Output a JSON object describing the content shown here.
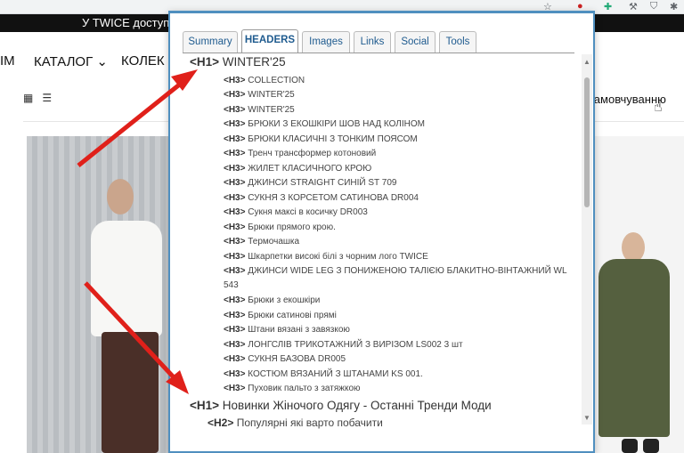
{
  "site": {
    "promo_text": "У TWICE доступн",
    "nav": [
      {
        "label": "ІМ"
      },
      {
        "label": "КАТАЛОГ ⌄"
      },
      {
        "label": "КОЛЕК"
      }
    ],
    "sort_label": "о замовчуванню"
  },
  "popup": {
    "tabs": [
      {
        "label": "Summary"
      },
      {
        "label": "HEADERS"
      },
      {
        "label": "Images"
      },
      {
        "label": "Links"
      },
      {
        "label": "Social"
      },
      {
        "label": "Tools"
      }
    ],
    "active_tab": "HEADERS",
    "headers": [
      {
        "tag": "<H1>",
        "text": "WINTER'25"
      },
      {
        "tag": "<H3>",
        "text": "COLLECTION"
      },
      {
        "tag": "<H3>",
        "text": "WINTER'25"
      },
      {
        "tag": "<H3>",
        "text": "WINTER'25"
      },
      {
        "tag": "<H3>",
        "text": "БРЮКИ З ЕКОШКІРИ ШОВ НАД КОЛІНОМ"
      },
      {
        "tag": "<H3>",
        "text": "БРЮКИ КЛАСИЧНІ З ТОНКИМ ПОЯСОМ"
      },
      {
        "tag": "<H3>",
        "text": "Тренч трансформер котоновий"
      },
      {
        "tag": "<H3>",
        "text": "ЖИЛЕТ КЛАСИЧНОГО КРОЮ"
      },
      {
        "tag": "<H3>",
        "text": "ДЖИНСИ STRAIGHT СИНІЙ ST 709"
      },
      {
        "tag": "<H3>",
        "text": "СУКНЯ З КОРСЕТОМ САТИНОВА DR004"
      },
      {
        "tag": "<H3>",
        "text": "Сукня максі в косичку DR003"
      },
      {
        "tag": "<H3>",
        "text": "Брюки прямого крою."
      },
      {
        "tag": "<H3>",
        "text": "Термочашка"
      },
      {
        "tag": "<H3>",
        "text": "Шкарпетки високі білі з чорним лого TWICE"
      },
      {
        "tag": "<H3>",
        "text": "ДЖИНСИ WIDE LEG З ПОНИЖЕНОЮ ТАЛІЄЮ БЛАКИТНО-ВІНТАЖНИЙ WL",
        "cont": "543"
      },
      {
        "tag": "<H3>",
        "text": "Брюки з екошкіри"
      },
      {
        "tag": "<H3>",
        "text": "Брюки сатинові прямі"
      },
      {
        "tag": "<H3>",
        "text": "Штани вязані з завязкою"
      },
      {
        "tag": "<H3>",
        "text": "ЛОНГСЛІВ ТРИКОТАЖНИЙ З ВИРІЗОМ LS002 3 шт"
      },
      {
        "tag": "<H3>",
        "text": "СУКНЯ БАЗОВА DR005"
      },
      {
        "tag": "<H3>",
        "text": "КОСТЮМ ВЯЗАНИЙ З ШТАНАМИ KS 001."
      },
      {
        "tag": "<H3>",
        "text": "Пуховик пальто з затяжкою"
      },
      {
        "tag": "<H1>",
        "text": "Новинки Жіночого Одягу - Останні Тренди Моди"
      },
      {
        "tag": "<H2>",
        "text": "Популярні які варто побачити"
      }
    ]
  },
  "colors": {
    "popup_border": "#4f8fbf",
    "tab_text": "#1f5b8f",
    "arrow": "#e0201a",
    "promo_bg": "#111111"
  }
}
